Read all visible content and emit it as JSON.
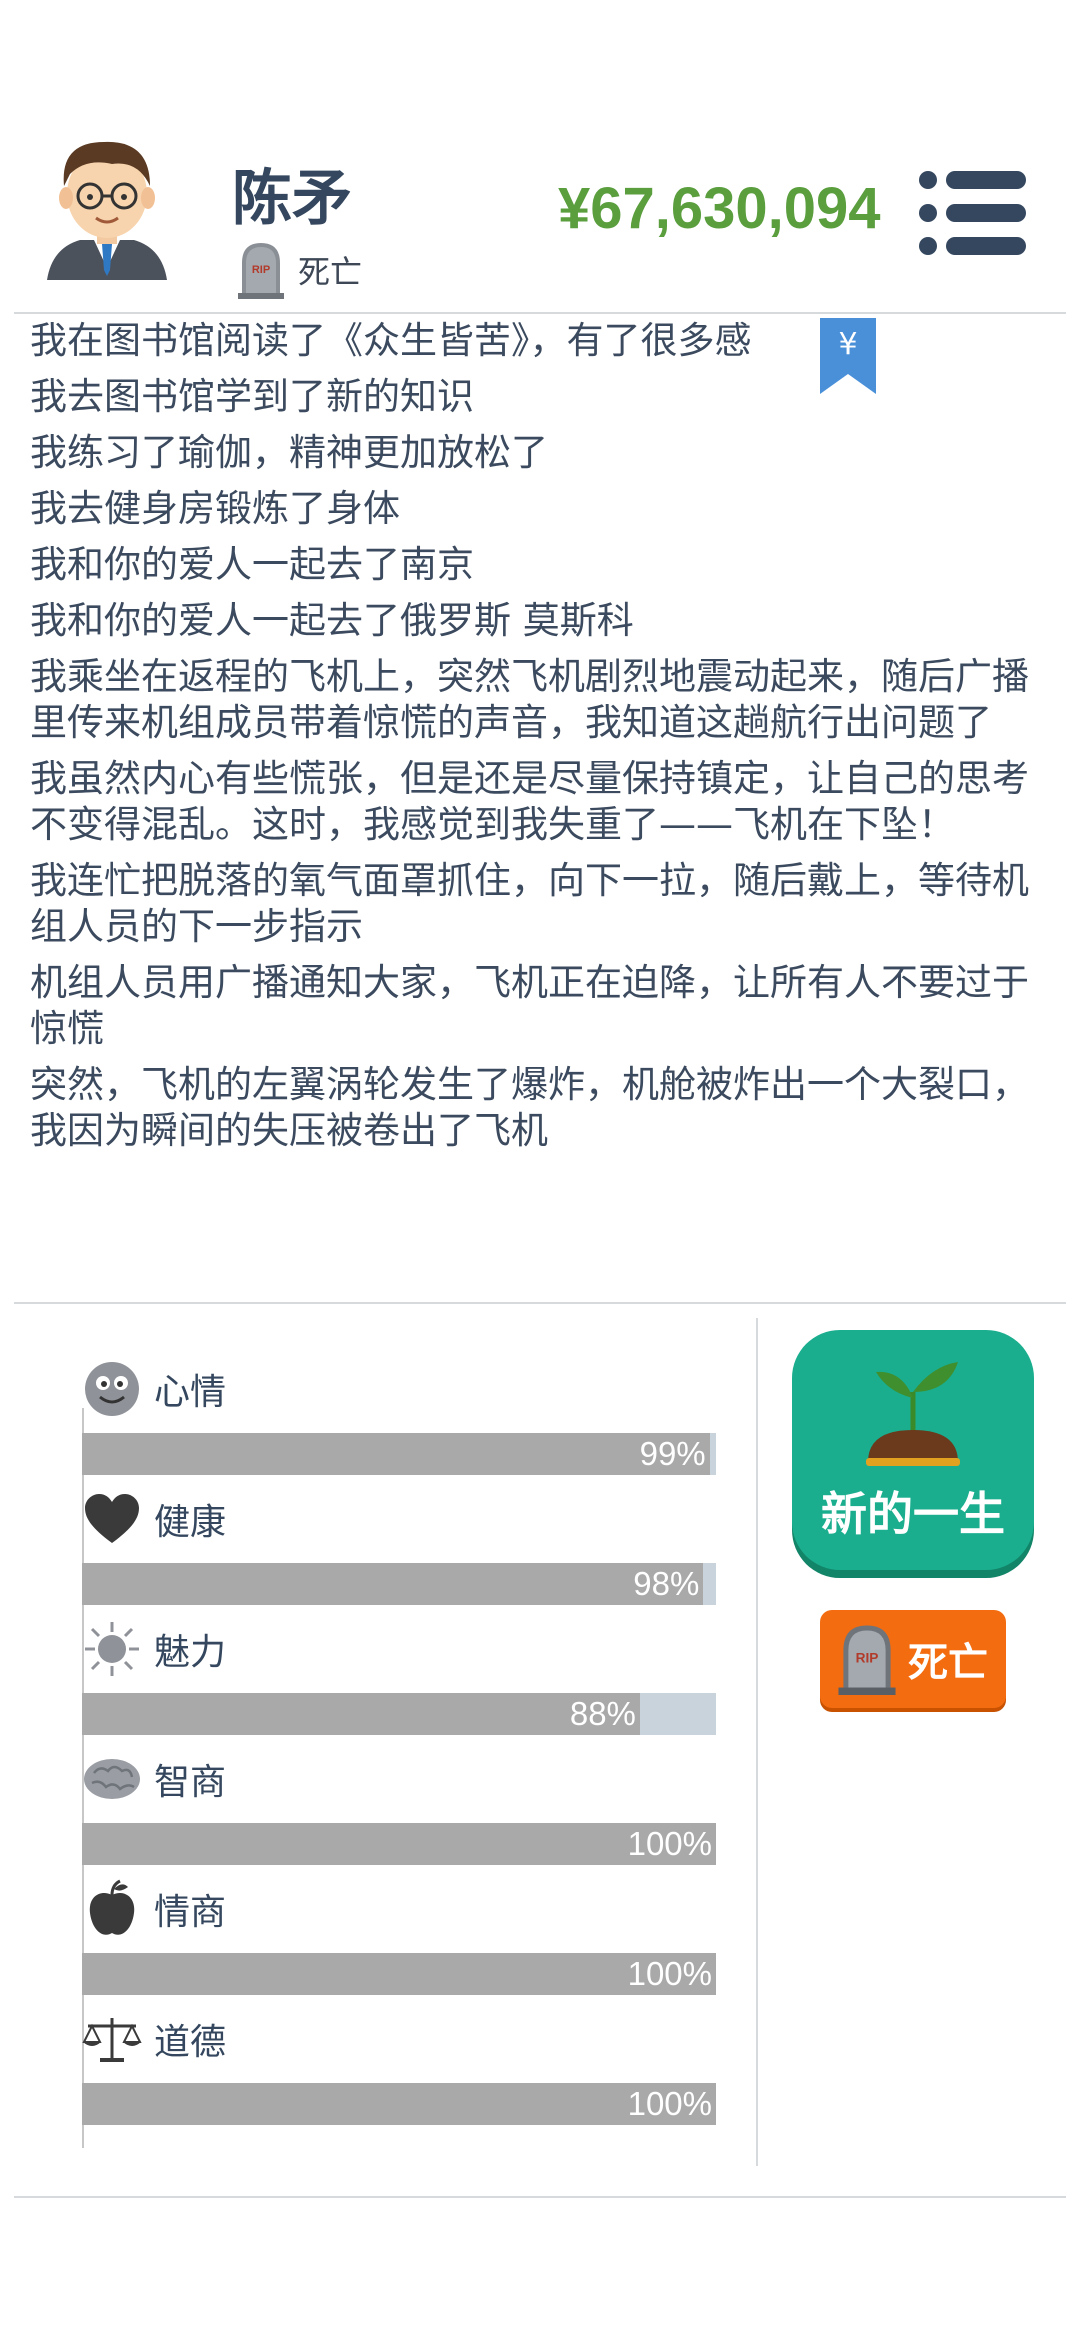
{
  "profile": {
    "name": "陈矛",
    "status": "死亡",
    "money": "¥67,630,094"
  },
  "log": [
    "我在图书馆阅读了《众生皆苦》，有了很多感",
    "我去图书馆学到了新的知识",
    "我练习了瑜伽，精神更加放松了",
    "我去健身房锻炼了身体",
    "我和你的爱人一起去了南京",
    "我和你的爱人一起去了俄罗斯 莫斯科",
    "我乘坐在返程的飞机上，突然飞机剧烈地震动起来，随后广播里传来机组成员带着惊慌的声音，我知道这趟航行出问题了",
    "我虽然内心有些慌张，但是还是尽量保持镇定，让自己的思考不变得混乱。这时，我感觉到我失重了——飞机在下坠！",
    "我连忙把脱落的氧气面罩抓住，向下一拉，随后戴上，等待机组人员的下一步指示",
    "机组人员用广播通知大家，飞机正在迫降，让所有人不要过于惊慌",
    "突然，飞机的左翼涡轮发生了爆炸，机舱被炸出一个大裂口，我因为瞬间的失压被卷出了飞机"
  ],
  "bookmark_symbol": "¥",
  "stats": [
    {
      "label": "心情",
      "icon": "smiley-icon",
      "percent": 99,
      "percent_label": "99%"
    },
    {
      "label": "健康",
      "icon": "heart-icon",
      "percent": 98,
      "percent_label": "98%"
    },
    {
      "label": "魅力",
      "icon": "sun-icon",
      "percent": 88,
      "percent_label": "88%"
    },
    {
      "label": "智商",
      "icon": "brain-icon",
      "percent": 100,
      "percent_label": "100%"
    },
    {
      "label": "情商",
      "icon": "apple-icon",
      "percent": 100,
      "percent_label": "100%"
    },
    {
      "label": "道德",
      "icon": "scales-icon",
      "percent": 100,
      "percent_label": "100%"
    }
  ],
  "actions": {
    "new_life_label": "新的一生",
    "dead_label": "死亡"
  },
  "colors": {
    "money": "#5a9e3e",
    "new_life_button": "#1aae8e",
    "dead_button": "#f36c10",
    "bar_fill": "#a9a9a9",
    "bar_track": "#c9d3dc"
  }
}
